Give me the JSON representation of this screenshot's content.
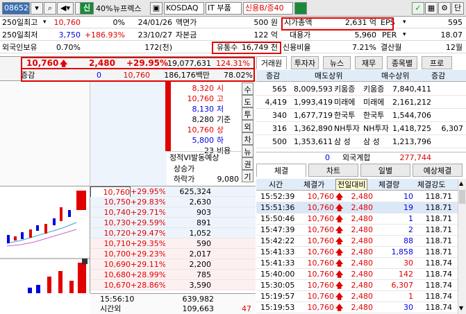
{
  "toolbar": {
    "code": "086520",
    "margin": "40%",
    "stock_name": "뉴프렉스",
    "credit_icon": "신",
    "market": "KOSDAQ",
    "sector": "IT 부품",
    "credit_rate": "신용B/증40",
    "single_button": "단"
  },
  "info": {
    "row1": {
      "label": "250일최고",
      "price": "10,760",
      "pct": "0%",
      "date": "24/01/26",
      "k2": "액면가",
      "v2": "500 원",
      "k3": "시가총액",
      "v3": "2,631 억",
      "k4": "EPS",
      "v4": "595"
    },
    "row2": {
      "label": "250일최저",
      "price": "3,750",
      "pct": "+186.93%",
      "date": "23/10/27",
      "k2": "자본금",
      "v2": "122 억",
      "k3": "대용가",
      "v3": "5,960",
      "k4": "PER",
      "v4": "18.07"
    },
    "row3": {
      "label": "외국인보유",
      "price": "0.70%",
      "pct": "",
      "date": "172(천)",
      "k2": "유통수",
      "v2": "16,749 천",
      "k3": "신용비율",
      "v3": "7.21%",
      "k4": "결산월",
      "v4": "12월"
    }
  },
  "quote": {
    "price": "10,760",
    "change": "2,480",
    "pct": "+29.95%",
    "volume": "19,077,631",
    "turnover": "124.31%",
    "label_change": "증감",
    "diff": "0",
    "price2": "10,760",
    "amount": "186,176백만",
    "ratio": "78.02%"
  },
  "summary": [
    {
      "v": "8,320",
      "k": "시",
      "c": "red"
    },
    {
      "v": "10,760",
      "k": "고",
      "c": "red"
    },
    {
      "v": "8,130",
      "k": "저",
      "c": "blue"
    },
    {
      "v": "8,280",
      "k": "기준",
      "c": ""
    },
    {
      "v": "10,760",
      "k": "상",
      "c": "red"
    },
    {
      "v": "5,800",
      "k": "하",
      "c": "blue"
    },
    {
      "v": "23",
      "k": "비용",
      "c": ""
    }
  ],
  "vi_text": {
    "l1": "정적VI발동예상",
    "l2": "상승가",
    "l3": "하락가",
    "down_price": "9,080"
  },
  "side_labels": [
    "수",
    "도",
    "투",
    "외",
    "차",
    "뉴",
    "권",
    "기"
  ],
  "orderbook": [
    {
      "price": "10,760",
      "pct": "+29.95%",
      "qty": "625,324",
      "sel": true
    },
    {
      "price": "10,750",
      "pct": "+29.83%",
      "qty": "2,630"
    },
    {
      "price": "10,740",
      "pct": "+29.71%",
      "qty": "903"
    },
    {
      "price": "10,730",
      "pct": "+29.59%",
      "qty": "891"
    },
    {
      "price": "10,720",
      "pct": "+29.47%",
      "qty": "1,052"
    },
    {
      "price": "10,710",
      "pct": "+29.35%",
      "qty": "590"
    },
    {
      "price": "10,700",
      "pct": "+29.23%",
      "qty": "2,017"
    },
    {
      "price": "10,690",
      "pct": "+29.11%",
      "qty": "2,200"
    },
    {
      "price": "10,680",
      "pct": "+28.99%",
      "qty": "785"
    },
    {
      "price": "10,670",
      "pct": "+28.86%",
      "qty": "3,590"
    }
  ],
  "ob_footer": {
    "time": "15:56:10",
    "label": "시간외",
    "v1": "639,982",
    "v2": "109,663",
    "v3": "47"
  },
  "right_tabs": [
    "거래원",
    "투자자",
    "뉴스",
    "재무",
    "종목별",
    "프로"
  ],
  "broker_head": {
    "c1": "증감",
    "c2": "매도상위",
    "c3": "매수상위",
    "c4": "증감"
  },
  "brokers": [
    {
      "d1": "565",
      "sv": "8,009,593",
      "sn": "키움증",
      "bn": "키움증",
      "bv": "7,840,411",
      "d2": ""
    },
    {
      "d1": "4,419",
      "sv": "1,993,419",
      "sn": "미래에",
      "bn": "미래에",
      "bv": "2,161,212",
      "d2": ""
    },
    {
      "d1": "340",
      "sv": "1,677,719",
      "sn": "한국투",
      "bn": "한국투",
      "bv": "1,544,706",
      "d2": ""
    },
    {
      "d1": "316",
      "sv": "1,362,890",
      "sn": "NH투자",
      "bn": "NH투자",
      "bv": "1,418,725",
      "d2": "6,307"
    },
    {
      "d1": "500",
      "sv": "1,353,611",
      "sn": "삼 성",
      "bn": "삼 성",
      "bv": "1,213,796",
      "d2": ""
    }
  ],
  "foreign": {
    "d1": "0",
    "label": "외국계합",
    "v": "277,744"
  },
  "trade_tabs": [
    "체결",
    "차트",
    "일별",
    "예상체결"
  ],
  "trade_head": {
    "c1": "시간",
    "c2": "체결가",
    "c3": "전일대비",
    "c4": "체결량",
    "c5": "체결강도"
  },
  "trades": [
    {
      "t": "15:52:39",
      "p": "10,760",
      "d": "2,480",
      "q": "10",
      "s": "118.71",
      "qc": "blue"
    },
    {
      "t": "15:51:36",
      "p": "10,760",
      "d": "2,480",
      "q": "19",
      "s": "118.71",
      "qc": "blue",
      "sel": true
    },
    {
      "t": "15:50:46",
      "p": "10,760",
      "d": "2,480",
      "q": "1",
      "s": "118.71",
      "qc": "blue"
    },
    {
      "t": "15:47:39",
      "p": "10,760",
      "d": "2,480",
      "q": "2",
      "s": "118.71",
      "qc": "blue"
    },
    {
      "t": "15:42:22",
      "p": "10,760",
      "d": "2,480",
      "q": "88",
      "s": "118.71",
      "qc": "blue"
    },
    {
      "t": "15:41:33",
      "p": "10,760",
      "d": "2,480",
      "q": "1,858",
      "s": "118.71",
      "qc": "blue"
    },
    {
      "t": "15:41:33",
      "p": "10,760",
      "d": "2,480",
      "q": "30",
      "s": "118.74",
      "qc": "red"
    },
    {
      "t": "15:40:00",
      "p": "10,760",
      "d": "2,480",
      "q": "142",
      "s": "118.74",
      "qc": "red"
    },
    {
      "t": "15:30:05",
      "p": "10,760",
      "d": "2,480",
      "q": "6,307",
      "s": "118.74",
      "qc": "red"
    },
    {
      "t": "15:19:57",
      "p": "10,760",
      "d": "2,480",
      "q": "1",
      "s": "118.74",
      "qc": "red"
    },
    {
      "t": "15:19:53",
      "p": "10,760",
      "d": "2,480",
      "q": "30",
      "s": "118.74",
      "qc": "blue"
    }
  ],
  "colors": {
    "up": "#e00000",
    "down": "#0000e0",
    "highlight": "#e00000",
    "accent_green": "#1a8a3a"
  }
}
